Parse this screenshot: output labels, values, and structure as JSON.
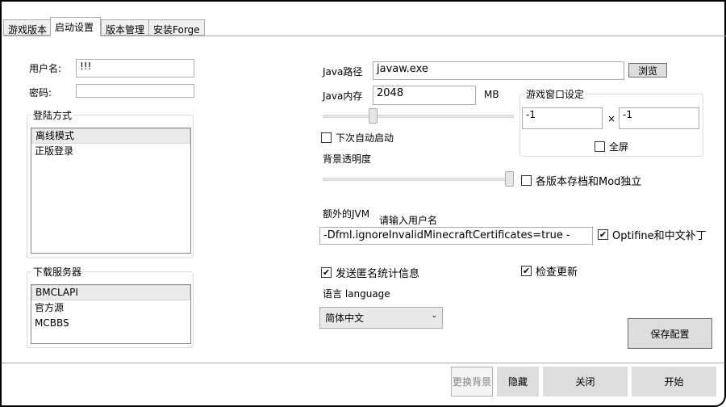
{
  "tabs": [
    {
      "label": "游戏版本"
    },
    {
      "label": "启动设置"
    },
    {
      "label": "版本管理"
    },
    {
      "label": "安装Forge"
    }
  ],
  "account": {
    "username_label": "用户名:",
    "username_value": "!!!",
    "password_label": "密码:",
    "password_value": ""
  },
  "login_mode": {
    "title": "登陆方式",
    "items": [
      "离线模式",
      "正版登录"
    ],
    "selected": "离线模式"
  },
  "download_server": {
    "title": "下载服务器",
    "items": [
      "BMCLAPI",
      "官方源",
      "MCBBS"
    ],
    "selected": "BMCLAPI"
  },
  "java": {
    "path_label": "Java路径",
    "path_value": "javaw.exe",
    "browse_label": "浏览",
    "memory_label": "Java内存",
    "memory_value": "2048",
    "memory_unit": "MB",
    "memory_slider_fraction": 0.25
  },
  "auto_start": {
    "label": "下次自动启动",
    "checked": false
  },
  "opacity": {
    "label": "背景透明度",
    "slider_fraction": 1.0
  },
  "window_settings": {
    "title": "游戏窗口设定",
    "width": "-1",
    "times": "×",
    "height": "-1",
    "fullscreen_label": "全屏",
    "fullscreen_checked": false
  },
  "isolate": {
    "label": "各版本存档和Mod独立",
    "checked": false
  },
  "jvm": {
    "label": "额外的JVM",
    "value": "-Dfml.ignoreInvalidMinecraftCertificates=true -Dfml.ignorePatchDiscrepancies=true",
    "tooltip": "请输入用户名"
  },
  "optifine": {
    "label": "Optifine和中文补丁",
    "checked": true
  },
  "stats": {
    "label": "发送匿名统计信息",
    "checked": true
  },
  "check_update": {
    "label": "检查更新",
    "checked": true
  },
  "language": {
    "label": "语言 language",
    "value": "简体中文"
  },
  "buttons": {
    "save": "保存配置",
    "change_bg": "更换背景",
    "hide": "隐藏",
    "close": "关闭",
    "start": "开始"
  },
  "check_glyph": "✔"
}
